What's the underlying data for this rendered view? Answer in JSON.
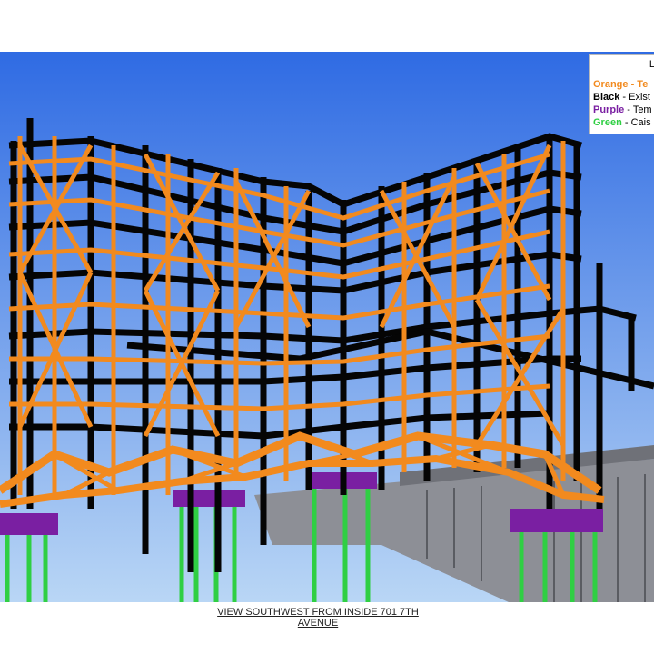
{
  "legend": {
    "title": "L",
    "items": [
      {
        "key": "Orange",
        "sep": " - ",
        "desc": "Te",
        "color": "#f28a1e"
      },
      {
        "key": "Black",
        "sep": " - ",
        "desc": "Exist",
        "color": "#000000"
      },
      {
        "key": "Purple",
        "sep": " - ",
        "desc": "Tem",
        "color": "#7a1fa2"
      },
      {
        "key": "Green",
        "sep": " - ",
        "desc": "Cais",
        "color": "#2fcf43"
      }
    ]
  },
  "caption": {
    "line1": "VIEW SOUTHWEST FROM INSIDE 701 7TH",
    "line2": "AVENUE"
  },
  "colors": {
    "sky_top": "#2f6be3",
    "sky_bottom": "#b9d6f5",
    "temporary_steel": "#f28a1e",
    "existing_steel": "#050505",
    "temporary_pads": "#7a1fa2",
    "caissons": "#2fcf43",
    "concrete_wall": "#8d8f96"
  }
}
